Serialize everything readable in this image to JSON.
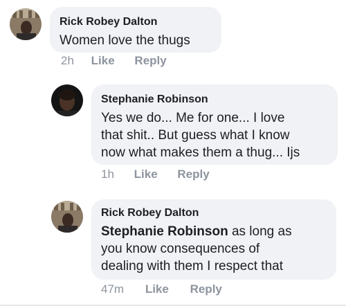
{
  "comments": [
    {
      "author": "Rick Robey Dalton",
      "text": "Women love the thugs",
      "time": "2h",
      "like_label": "Like",
      "reply_label": "Reply"
    },
    {
      "author": "Stephanie Robinson",
      "lines": [
        "Yes we do... Me for one... I love",
        "that shit.. But guess what I know",
        "now what makes them a thug... Ijs"
      ],
      "time": "1h",
      "like_label": "Like",
      "reply_label": "Reply"
    },
    {
      "author": "Rick Robey Dalton",
      "mention": "Stephanie Robinson",
      "lines": [
        " as long as",
        "you know consequences of",
        "dealing with them I respect that"
      ],
      "time": "47m",
      "like_label": "Like",
      "reply_label": "Reply"
    }
  ],
  "avatars": {
    "rick": "person-photo-icon",
    "stephanie": "person-photo-icon"
  }
}
